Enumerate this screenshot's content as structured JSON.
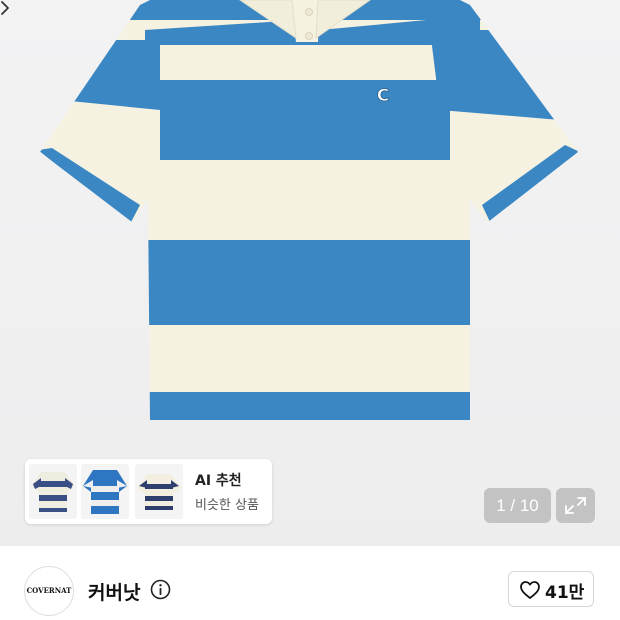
{
  "gallery": {
    "counter_text": "1 / 10",
    "colors": {
      "stripe_blue": "#3a87c4",
      "stripe_cream": "#f5f2e1"
    }
  },
  "ai_recommend": {
    "title": "AI 추천",
    "subtitle": "비슷한 상품",
    "thumbnails": [
      "navy-stripe-polo",
      "blue-stripe-polo",
      "navy-stripe-knit"
    ]
  },
  "brand": {
    "logo_text": "COVERNAT",
    "name": "커버낫"
  },
  "like": {
    "count": "41만"
  },
  "icons": [
    "chevron-right-icon",
    "expand-icon",
    "info-icon",
    "heart-icon"
  ]
}
